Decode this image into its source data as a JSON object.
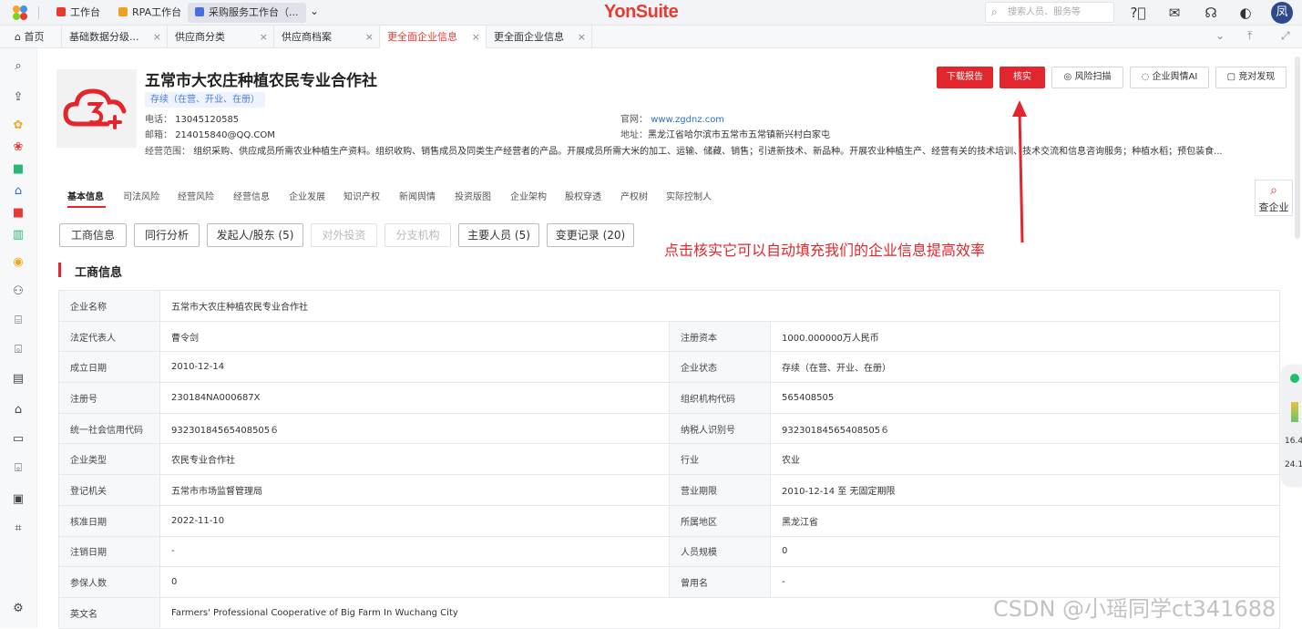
{
  "topbar": {
    "tabs": [
      {
        "label": "工作台",
        "color": "#e83a30"
      },
      {
        "label": "RPA工作台",
        "color": "#f0a020"
      },
      {
        "label": "采购服务工作台（...",
        "color": "#4a6ee0"
      }
    ],
    "brand": "YonSuite",
    "search_placeholder": "搜索人员、服务等",
    "avatar": "凤"
  },
  "page_tabs": [
    {
      "label": "首页"
    },
    {
      "label": "基础数据分级..."
    },
    {
      "label": "供应商分类"
    },
    {
      "label": "供应商档案"
    },
    {
      "label": "更全面企业信息"
    },
    {
      "label": "更全面企业信息"
    }
  ],
  "company": {
    "name": "五常市大农庄种植农民专业合作社",
    "status": "存续（在营、开业、在册）",
    "phone_label": "电话：",
    "phone": "13045120585",
    "email_label": "邮箱：",
    "email": "214015840@QQ.COM",
    "website_label": "官网：",
    "website": "www.zgdnz.com",
    "address_label": "地址：",
    "address": "黑龙江省哈尔滨市五常市五常镇新兴村白家屯",
    "scope_label": "经营范围：",
    "scope": "组织采购、供应成员所需农业种植生产资料。组织收购、销售成员及同类生产经营者的产品。开展成员所需大米的加工、运输、储藏、销售；引进新技术、新品种。开展农业种植生产、经营有关的技术培训、技术交流和信息咨询服务；种植水稻；预包装食..."
  },
  "actions": {
    "download": "下载报告",
    "verify": "核实",
    "risk_scan": "风险扫描",
    "sentiment_ai": "企业舆情AI",
    "discover": "竞对发现"
  },
  "sub_nav": [
    "基本信息",
    "司法风险",
    "经营风险",
    "经营信息",
    "企业发展",
    "知识产权",
    "新闻舆情",
    "投资版图",
    "企业架构",
    "股权穿透",
    "产权树",
    "实际控制人"
  ],
  "cha_button": "查企业",
  "pills": [
    {
      "label": "工商信息",
      "disabled": false
    },
    {
      "label": "同行分析",
      "disabled": false
    },
    {
      "label": "发起人/股东 (5)",
      "disabled": false
    },
    {
      "label": "对外投资",
      "disabled": true
    },
    {
      "label": "分支机构",
      "disabled": true
    },
    {
      "label": "主要人员 (5)",
      "disabled": false
    },
    {
      "label": "变更记录 (20)",
      "disabled": false
    }
  ],
  "section_title": "工商信息",
  "annotation": "点击核实它可以自动填充我们的企业信息提高效率",
  "table": {
    "company_name_label": "企业名称",
    "company_name": "五常市大农庄种植农民专业合作社",
    "rows": [
      [
        "法定代表人",
        "曹令剑",
        "注册资本",
        "1000.000000万人民币"
      ],
      [
        "成立日期",
        "2010-12-14",
        "企业状态",
        "存续（在营、开业、在册）"
      ],
      [
        "注册号",
        "230184NA000687X",
        "组织机构代码",
        "565408505"
      ],
      [
        "统一社会信用代码",
        "93230184565408505６",
        "纳税人识别号",
        "93230184565408505６"
      ],
      [
        "企业类型",
        "农民专业合作社",
        "行业",
        "农业"
      ],
      [
        "登记机关",
        "五常市市场监督管理局",
        "营业期限",
        "2010-12-14 至 无固定期限"
      ],
      [
        "核准日期",
        "2022-11-10",
        "所属地区",
        "黑龙江省"
      ],
      [
        "注销日期",
        "-",
        "人员规模",
        "0"
      ],
      [
        "参保人数",
        "0",
        "曾用名",
        "-"
      ]
    ],
    "english_label": "英文名",
    "english_name": "Farmers' Professional Cooperative of Big Farm In Wuchang City"
  },
  "widget": {
    "v1": "16.4",
    "v2": "24.1"
  },
  "watermark": "CSDN @小瑶同学ct341688"
}
